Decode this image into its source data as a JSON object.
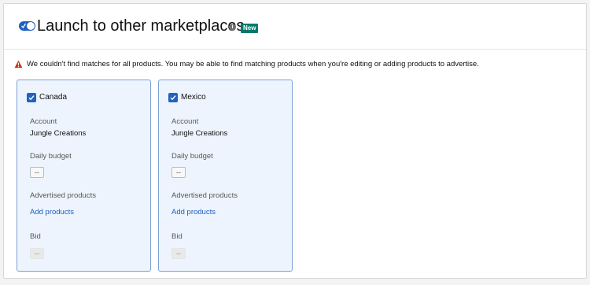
{
  "header": {
    "title": "Launch to other marketplaces",
    "info_icon": "i",
    "badge": "New"
  },
  "warning": {
    "text": "We couldn't find matches for all products. You may be able to find matching products when you're editing or adding products to advertise."
  },
  "marketplaces": [
    {
      "name": "Canada",
      "checked": true,
      "account_label": "Account",
      "account_value": "Jungle Creations",
      "daily_budget_label": "Daily budget",
      "daily_budget_value": "--",
      "advertised_products_label": "Advertised products",
      "add_products_link": "Add products",
      "bid_label": "Bid",
      "bid_value": "--"
    },
    {
      "name": "Mexico",
      "checked": true,
      "account_label": "Account",
      "account_value": "Jungle Creations",
      "daily_budget_label": "Daily budget",
      "daily_budget_value": "--",
      "advertised_products_label": "Advertised products",
      "add_products_link": "Add products",
      "bid_label": "Bid",
      "bid_value": "--"
    }
  ],
  "colors": {
    "accent_blue": "#1f5fbf",
    "badge_green": "#00796b",
    "warning_orange": "#d13212",
    "card_bg": "#edf4fd",
    "card_border": "#7ea1d3"
  }
}
